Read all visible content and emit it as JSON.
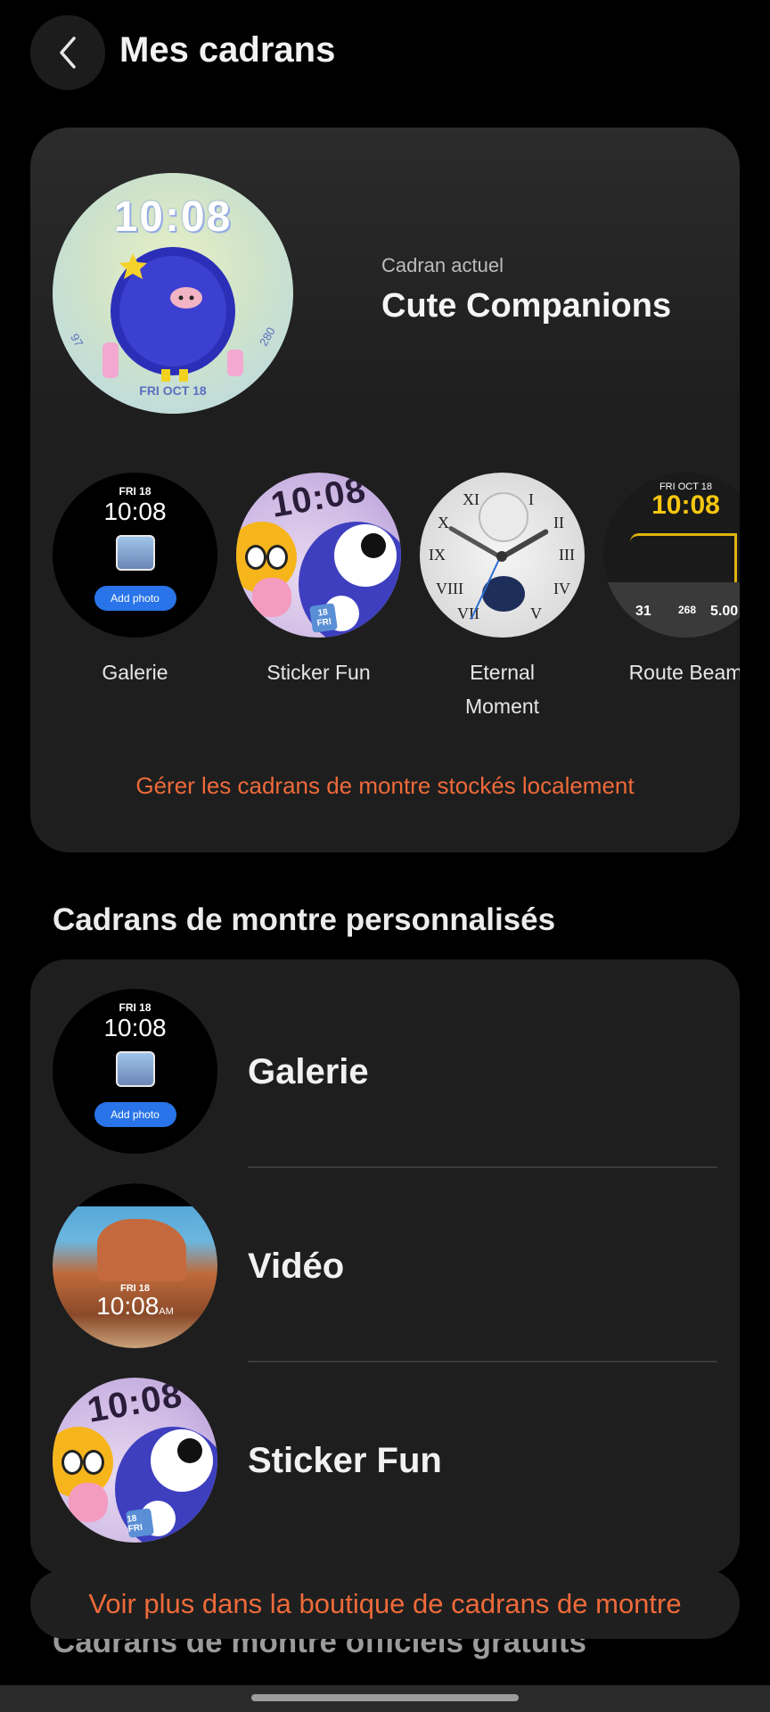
{
  "header": {
    "title": "Mes cadrans",
    "back_icon": "chevron-left-icon"
  },
  "current_face": {
    "label": "Cadran actuel",
    "name": "Cute Companions",
    "preview": {
      "time": "10:08",
      "date": "FRI OCT 18",
      "left_number": "97",
      "right_number": "280"
    }
  },
  "carousel": [
    {
      "label": "Galerie",
      "date": "FRI 18",
      "time": "10:08",
      "button": "Add photo"
    },
    {
      "label": "Sticker Fun",
      "time": "10:08",
      "badge": "18 FRI"
    },
    {
      "label": "Eternal\nMoment",
      "label_line1": "Eternal",
      "label_line2": "Moment"
    },
    {
      "label": "Route Beam",
      "date": "FRI OCT 18",
      "time": "10:08",
      "left_value": "31",
      "center_value": "268",
      "right_value": "5.00"
    }
  ],
  "manage_link": "Gérer les cadrans de montre stockés localement",
  "custom_section": {
    "title": "Cadrans de montre personnalisés",
    "items": [
      {
        "label": "Galerie",
        "date": "FRI 18",
        "time": "10:08",
        "button": "Add photo"
      },
      {
        "label": "Vidéo",
        "date": "FRI 18",
        "time": "10:08",
        "suffix": "AM"
      },
      {
        "label": "Sticker Fun",
        "time": "10:08",
        "badge": "18 FRI"
      }
    ]
  },
  "store_link": "Voir plus dans la boutique de cadrans de montre",
  "next_section_title": "Cadrans de montre officiels gratuits",
  "colors": {
    "accent": "#ee6a3a",
    "card": "#1e1e1e",
    "background": "#000000"
  }
}
